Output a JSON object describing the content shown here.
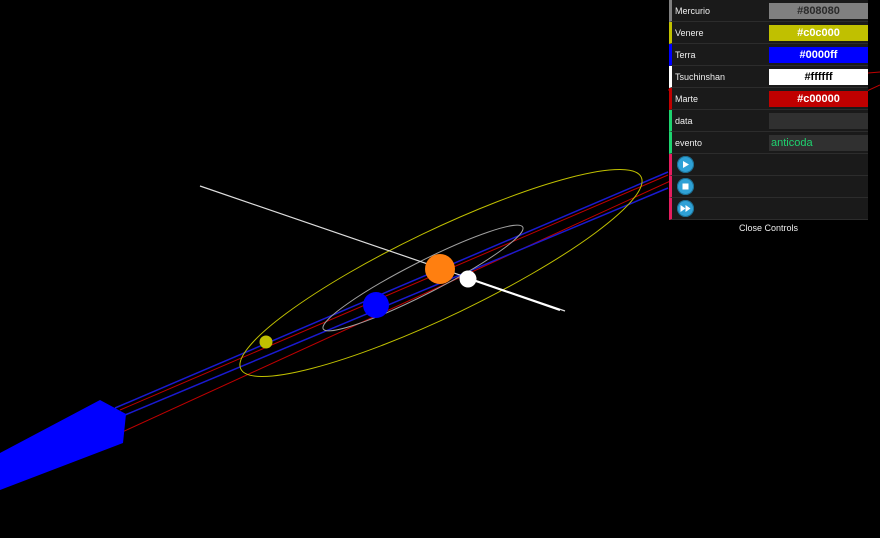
{
  "controls": [
    {
      "label": "Mercurio",
      "value": "#808080",
      "swatch": "#808080",
      "text_color": "#2a2a2a",
      "border": "#808080"
    },
    {
      "label": "Venere",
      "value": "#c0c000",
      "swatch": "#c0c000",
      "text_color": "#ffffff",
      "border": "#c0c000"
    },
    {
      "label": "Terra",
      "value": "#0000ff",
      "swatch": "#0000ff",
      "text_color": "#ffffff",
      "border": "#0000ff"
    },
    {
      "label": "Tsuchinshan",
      "value": "#ffffff",
      "swatch": "#ffffff",
      "text_color": "#000000",
      "border": "#ffffff"
    },
    {
      "label": "Marte",
      "value": "#c00000",
      "swatch": "#c00000",
      "text_color": "#ffffff",
      "border": "#c00000"
    }
  ],
  "data_field": {
    "label": "data",
    "value": ""
  },
  "evento_field": {
    "label": "evento",
    "value": "anticoda",
    "value_color": "#1ed36f"
  },
  "buttons": [
    {
      "icon": "play-icon"
    },
    {
      "icon": "stop-icon"
    },
    {
      "icon": "fast-forward-icon"
    }
  ],
  "close_label": "Close Controls",
  "colors": {
    "background": "#000000",
    "sun": "#ff7f10",
    "terra": "#0000ff",
    "venere": "#c0c000",
    "tsuchinshan": "#ffffff",
    "marte": "#c00000",
    "axis": "#ffffff",
    "comet_tail": "#0000ff"
  }
}
